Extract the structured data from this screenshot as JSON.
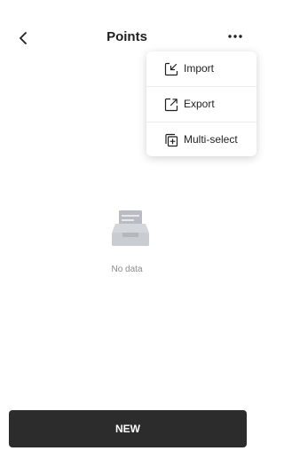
{
  "header": {
    "title": "Points",
    "back_icon": "chevron-left-icon",
    "more_icon": "more-horizontal-icon"
  },
  "menu": {
    "items": [
      {
        "label": "Import",
        "icon": "import-icon"
      },
      {
        "label": "Export",
        "icon": "export-icon"
      },
      {
        "label": "Multi-select",
        "icon": "multi-select-icon"
      }
    ]
  },
  "empty_state": {
    "text": "No data",
    "icon": "empty-inbox-icon"
  },
  "footer": {
    "new_label": "NEW"
  },
  "colors": {
    "primary_button": "#2c2c2c",
    "muted_text": "#8c8c8c",
    "illustration": "#c9ccd1"
  }
}
